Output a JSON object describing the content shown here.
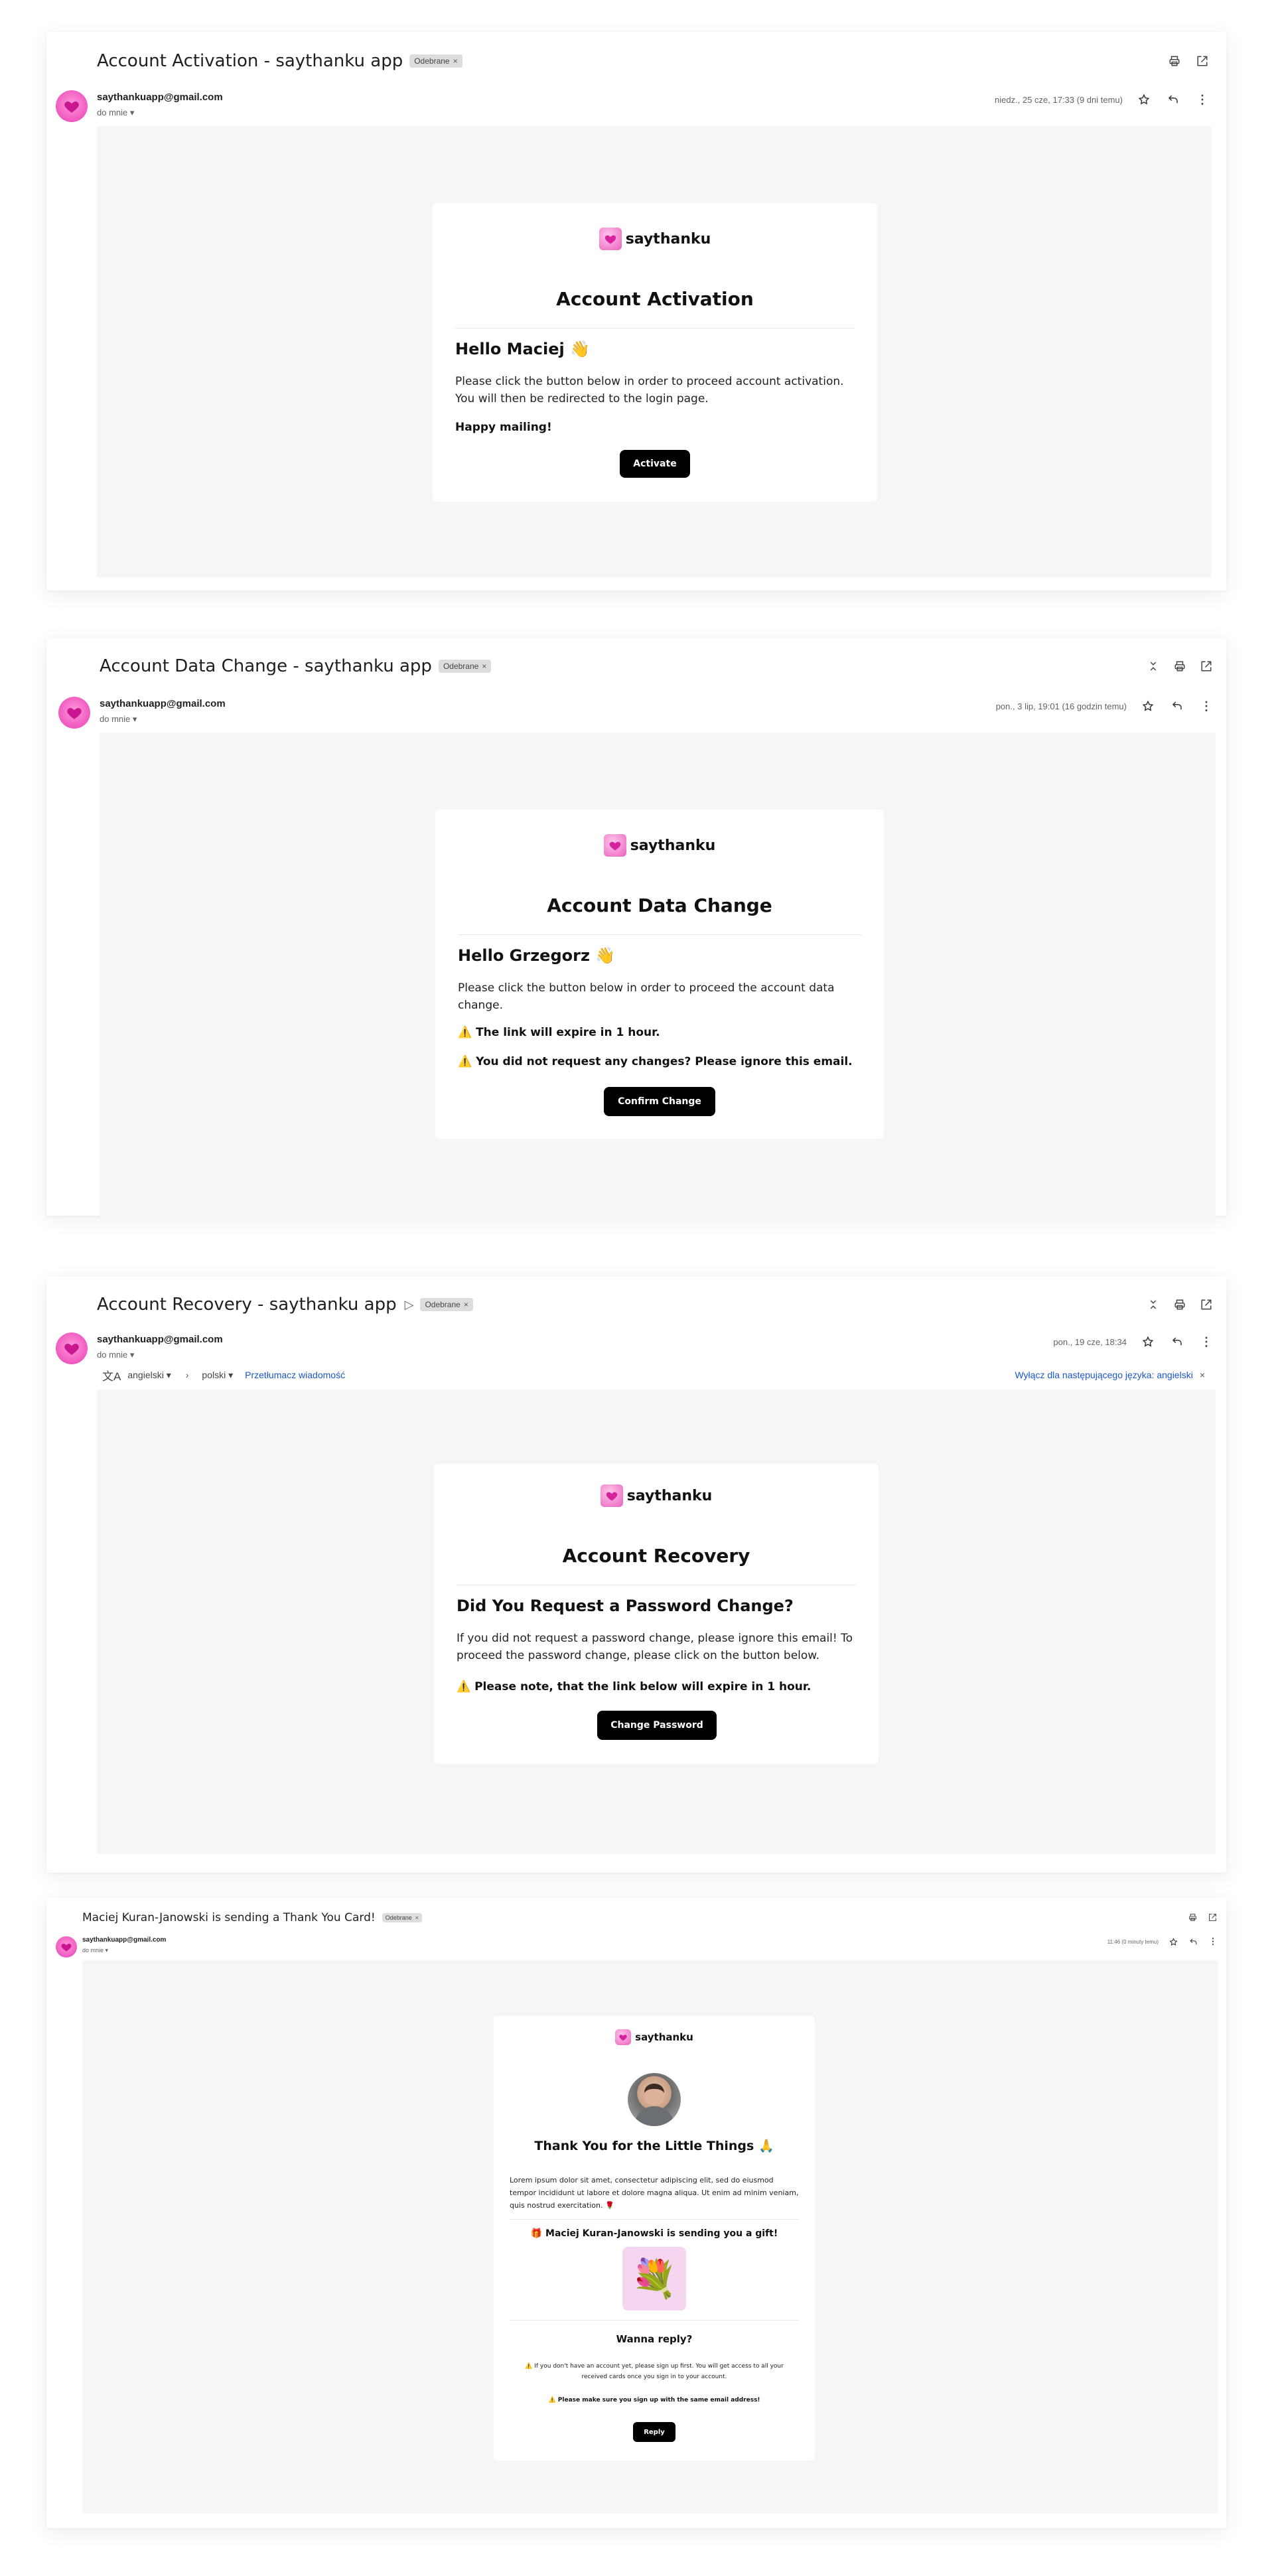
{
  "emails": [
    {
      "subject": "Account Activation - saythanku app",
      "label": "Odebrane",
      "sender": "saythankuapp@gmail.com",
      "to": "do mnie",
      "date": "niedz., 25 cze, 17:33 (9 dni temu)",
      "brand": "saythanku",
      "title": "Account Activation",
      "greeting": "Hello Maciej 👋",
      "paragraph": "Please click the button below in order to proceed account activation. You will then be redirected to the login page.",
      "signoff": "Happy mailing!",
      "button": "Activate"
    },
    {
      "subject": "Account Data Change - saythanku app",
      "label": "Odebrane",
      "sender": "saythankuapp@gmail.com",
      "to": "do mnie",
      "date": "pon., 3 lip, 19:01 (16 godzin temu)",
      "brand": "saythanku",
      "title": "Account Data Change",
      "greeting": "Hello Grzegorz 👋",
      "paragraph": "Please click the button below in order to proceed the account data change.",
      "warning1": "⚠️ The link will expire in 1 hour.",
      "warning2": "⚠️ You did not request any changes? Please ignore this email.",
      "button": "Confirm Change"
    },
    {
      "subject": "Account Recovery - saythanku app",
      "label": "Odebrane",
      "sender": "saythankuapp@gmail.com",
      "to": "do mnie",
      "date": "pon., 19 cze, 18:34",
      "translate": {
        "from": "angielski",
        "to": "polski",
        "translate_link": "Przetłumacz wiadomość",
        "disable_link": "Wyłącz dla następującego języka: angielski"
      },
      "brand": "saythanku",
      "title": "Account Recovery",
      "greeting": "Did You Request a Password Change?",
      "paragraph": "If you did not request a password change, please ignore this email! To proceed the password change, please click on the button below.",
      "warning1": "⚠️ Please note, that the link below will expire in 1 hour.",
      "button": "Change Password"
    },
    {
      "subject": "Maciej Kuran-Janowski is sending a Thank You Card!",
      "label": "Odebrane",
      "sender": "saythankuapp@gmail.com",
      "to": "do mnie",
      "date": "11:46 (0 minuty temu)",
      "brand": "saythanku",
      "title": "Thank You for the Little Things 🙏",
      "paragraph": "Lorem ipsum dolor sit amet, consectetur adipiscing elit, sed do eiusmod tempor incididunt ut labore et dolore magna aliqua. Ut enim ad minim veniam, quis nostrud exercitation. 🌹",
      "gift_line": "🎁 Maciej Kuran-Janowski is sending you a gift!",
      "gift_emoji": "💐",
      "reply_title": "Wanna reply?",
      "note1": "⚠️ If you don't have an account yet, please sign up first. You will get access to all your received cards once you sign in to your account.",
      "note2": "⚠️ Please make sure you sign up with the same email address!",
      "button": "Reply"
    }
  ],
  "colors": {
    "brand_pink": "#f260c4",
    "button": "#000000",
    "link": "#1a57c8",
    "body_bg": "#f6f6f6"
  }
}
